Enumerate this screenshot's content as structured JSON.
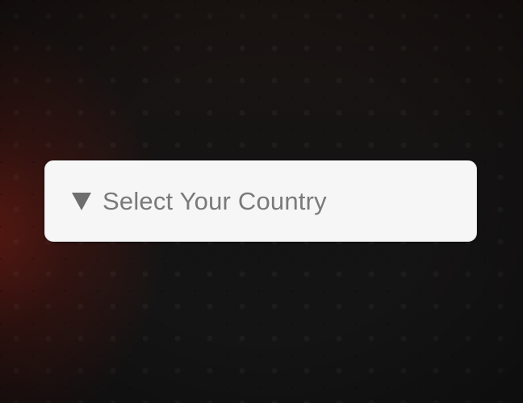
{
  "country_select": {
    "icon": "triangle-down-icon",
    "label": "Select Your Country"
  },
  "colors": {
    "background": "#141414",
    "background_glow": "#781e14",
    "select_background": "#f6f6f6",
    "select_text": "#7a7a7a",
    "select_icon": "#6e6e6e"
  }
}
